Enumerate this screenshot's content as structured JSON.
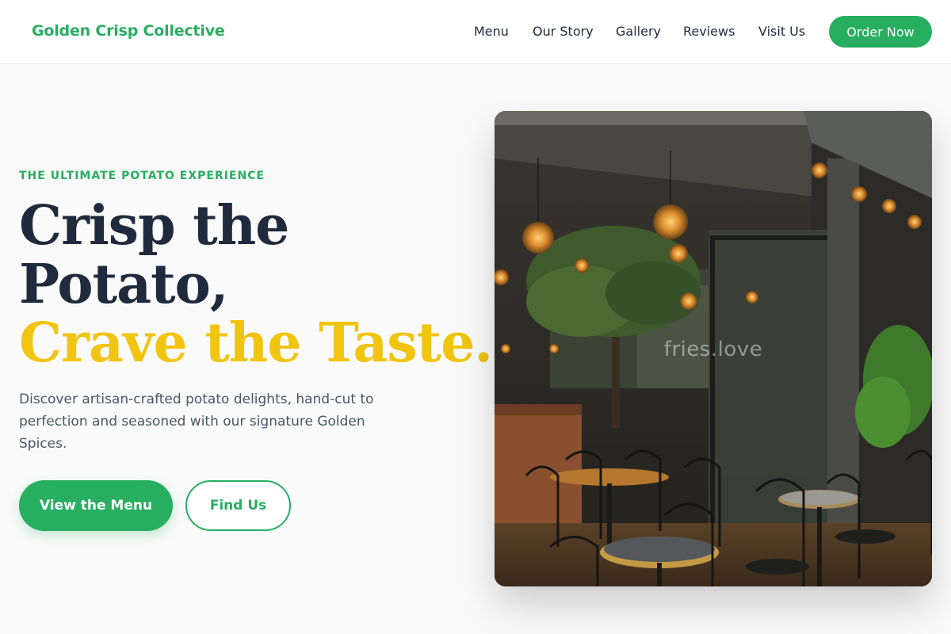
{
  "header": {
    "brand": "Golden Crisp Collective",
    "nav": [
      "Menu",
      "Our Story",
      "Gallery",
      "Reviews",
      "Visit Us"
    ],
    "cta_label": "Order Now"
  },
  "hero": {
    "eyebrow": "THE ULTIMATE POTATO EXPERIENCE",
    "headline_line1": "Crisp the",
    "headline_line2": "Potato,",
    "headline_accent": "Crave the Taste.",
    "description": "Discover artisan-crafted potato delights, hand-cut to perfection and seasoned with our signature Golden Spices.",
    "primary_button": "View the Menu",
    "secondary_button": "Find Us",
    "image_watermark": "fries.love"
  },
  "colors": {
    "brand_green": "#27ae60",
    "accent_yellow": "#f1c40f",
    "heading_navy": "#1f2a3c"
  }
}
